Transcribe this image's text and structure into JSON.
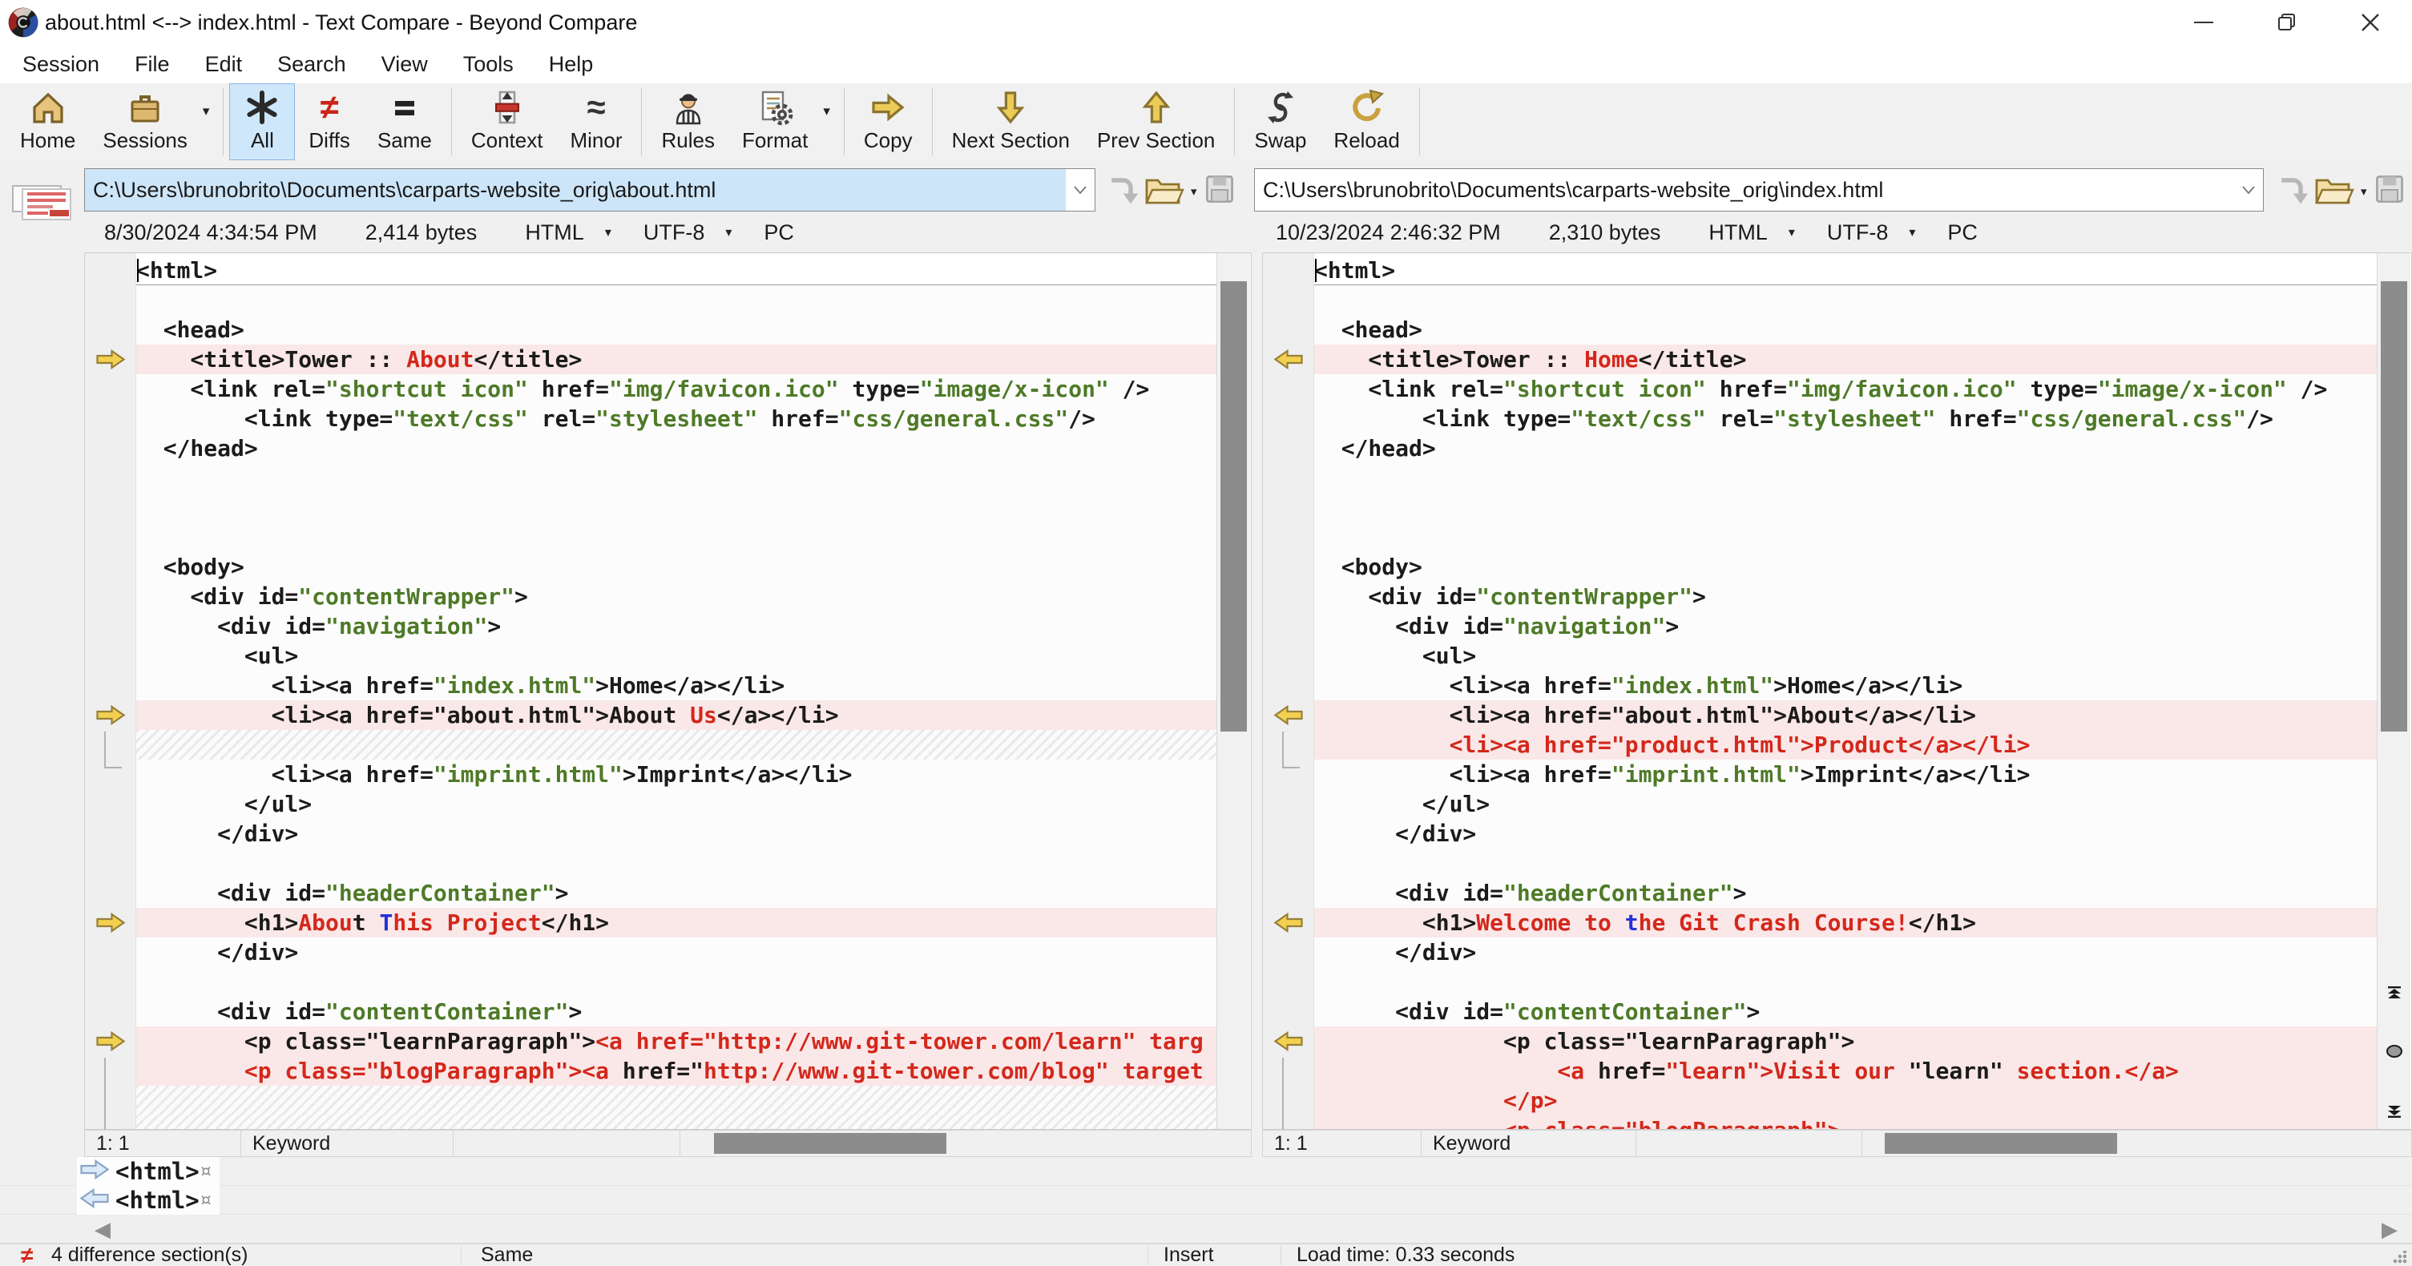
{
  "window": {
    "title": "about.html <--> index.html - Text Compare - Beyond Compare",
    "buttons": {
      "minimize": "minimize",
      "restore": "restore",
      "close": "close"
    }
  },
  "menu": {
    "items": [
      "Session",
      "File",
      "Edit",
      "Search",
      "View",
      "Tools",
      "Help"
    ]
  },
  "toolbar": {
    "groups": [
      [
        {
          "icon": "home-icon",
          "label": "Home"
        },
        {
          "icon": "sessions-icon",
          "label": "Sessions",
          "dropdown": true
        }
      ],
      [
        {
          "icon": "all-icon",
          "label": "All",
          "selected": true
        },
        {
          "icon": "diffs-icon",
          "label": "Diffs"
        },
        {
          "icon": "same-icon",
          "label": "Same"
        }
      ],
      [
        {
          "icon": "context-icon",
          "label": "Context"
        },
        {
          "icon": "minor-icon",
          "label": "Minor"
        }
      ],
      [
        {
          "icon": "rules-icon",
          "label": "Rules"
        },
        {
          "icon": "format-icon",
          "label": "Format",
          "dropdown": true
        }
      ],
      [
        {
          "icon": "copy-icon",
          "label": "Copy"
        }
      ],
      [
        {
          "icon": "next-section-icon",
          "label": "Next Section"
        },
        {
          "icon": "prev-section-icon",
          "label": "Prev Section"
        }
      ],
      [
        {
          "icon": "swap-icon",
          "label": "Swap"
        },
        {
          "icon": "reload-icon",
          "label": "Reload"
        }
      ]
    ]
  },
  "left_file": {
    "path": "C:\\Users\\brunobrito\\Documents\\carparts-website_orig\\about.html",
    "date": "8/30/2024 4:34:54 PM",
    "size": "2,414 bytes",
    "format": "HTML",
    "encoding": "UTF-8",
    "line_ending": "PC",
    "footer": {
      "position": "1: 1",
      "grammar": "Keyword"
    }
  },
  "right_file": {
    "path": "C:\\Users\\brunobrito\\Documents\\carparts-website_orig\\index.html",
    "date": "10/23/2024 2:46:32 PM",
    "size": "2,310 bytes",
    "format": "HTML",
    "encoding": "UTF-8",
    "line_ending": "PC",
    "footer": {
      "position": "1: 1",
      "grammar": "Keyword"
    }
  },
  "colors": {
    "diff_row_bg": "#fae7e7",
    "diff_text": "#d3281c",
    "unimportant_diff_text": "#2431d8",
    "string_value": "#4e7a27",
    "selected_path_bg": "#cde5f8",
    "selected_tool_bg": "#cfe7fb",
    "gutter_arrow": "#f3d04f",
    "scrollbar_thumb": "#8c8c8c"
  },
  "left_rows": [
    {
      "c": 1,
      "s": [
        [
          "k",
          "<html>"
        ]
      ]
    },
    {},
    {
      "s": [
        [
          "k",
          "  <head>"
        ]
      ]
    },
    {
      "d": 1,
      "a": 1,
      "s": [
        [
          "k",
          "    <title>Tower :: "
        ],
        [
          "r",
          "About"
        ],
        [
          "k",
          "</title>"
        ]
      ]
    },
    {
      "s": [
        [
          "k",
          "    <link rel="
        ],
        [
          "g",
          "\"shortcut icon\""
        ],
        [
          "k",
          " href="
        ],
        [
          "g",
          "\"img/favicon.ico\""
        ],
        [
          "k",
          " type="
        ],
        [
          "g",
          "\"image/x-icon\""
        ],
        [
          "k",
          " />"
        ]
      ]
    },
    {
      "s": [
        [
          "k",
          "        <link type="
        ],
        [
          "g",
          "\"text/css\""
        ],
        [
          "k",
          " rel="
        ],
        [
          "g",
          "\"stylesheet\""
        ],
        [
          "k",
          " href="
        ],
        [
          "g",
          "\"css/general.css\""
        ],
        [
          "k",
          "/>"
        ]
      ]
    },
    {
      "s": [
        [
          "k",
          "  </head>"
        ]
      ]
    },
    {},
    {},
    {},
    {
      "s": [
        [
          "k",
          "  <body>"
        ]
      ]
    },
    {
      "s": [
        [
          "k",
          "    <div id="
        ],
        [
          "g",
          "\"contentWrapper\""
        ],
        [
          "k",
          ">"
        ]
      ]
    },
    {
      "s": [
        [
          "k",
          "      <div id="
        ],
        [
          "g",
          "\"navigation\""
        ],
        [
          "k",
          ">"
        ]
      ]
    },
    {
      "s": [
        [
          "k",
          "        <ul>"
        ]
      ]
    },
    {
      "s": [
        [
          "k",
          "          <li><a href="
        ],
        [
          "g",
          "\"index.html\""
        ],
        [
          "k",
          ">Home</a></li>"
        ]
      ]
    },
    {
      "d": 1,
      "a": 1,
      "b": "corner",
      "s": [
        [
          "k",
          "          <li><a href=\"about.html\">About "
        ],
        [
          "r",
          "Us"
        ],
        [
          "k",
          "</a></li>"
        ]
      ]
    },
    {
      "g": 1
    },
    {
      "s": [
        [
          "k",
          "          <li><a href="
        ],
        [
          "g",
          "\"imprint.html\""
        ],
        [
          "k",
          ">Imprint</a></li>"
        ]
      ]
    },
    {
      "s": [
        [
          "k",
          "        </ul>"
        ]
      ]
    },
    {
      "s": [
        [
          "k",
          "      </div>"
        ]
      ]
    },
    {},
    {
      "s": [
        [
          "k",
          "      <div id="
        ],
        [
          "g",
          "\"headerContainer\""
        ],
        [
          "k",
          ">"
        ]
      ]
    },
    {
      "d": 1,
      "a": 1,
      "s": [
        [
          "k",
          "        <h1>"
        ],
        [
          "r",
          "Abou"
        ],
        [
          "k",
          "t "
        ],
        [
          "b",
          "T"
        ],
        [
          "r",
          "his Project"
        ],
        [
          "k",
          "</h1>"
        ]
      ]
    },
    {
      "s": [
        [
          "k",
          "      </div>"
        ]
      ]
    },
    {},
    {
      "s": [
        [
          "k",
          "      <div id="
        ],
        [
          "g",
          "\"contentContainer\""
        ],
        [
          "k",
          ">"
        ]
      ]
    },
    {
      "d": 1,
      "a": 1,
      "b": "line",
      "s": [
        [
          "k",
          "        <p class=\"learnParagraph\">"
        ],
        [
          "r",
          "<a href=\"http://www.git-tower.com/learn\" targ"
        ]
      ]
    },
    {
      "d": 1,
      "s": [
        [
          "r",
          "        <p class=\"blogParagraph\"><a "
        ],
        [
          "k",
          "href=\""
        ],
        [
          "r",
          "http://www.git-tower.com/blog\" target"
        ]
      ]
    },
    {
      "g": 1
    },
    {
      "g": 1
    }
  ],
  "right_rows": [
    {
      "c": 1,
      "s": [
        [
          "k",
          "<html>"
        ]
      ]
    },
    {},
    {
      "s": [
        [
          "k",
          "  <head>"
        ]
      ]
    },
    {
      "d": 1,
      "a": 1,
      "s": [
        [
          "k",
          "    <title>Tower :: "
        ],
        [
          "r",
          "Home"
        ],
        [
          "k",
          "</title>"
        ]
      ]
    },
    {
      "s": [
        [
          "k",
          "    <link rel="
        ],
        [
          "g",
          "\"shortcut icon\""
        ],
        [
          "k",
          " href="
        ],
        [
          "g",
          "\"img/favicon.ico\""
        ],
        [
          "k",
          " type="
        ],
        [
          "g",
          "\"image/x-icon\""
        ],
        [
          "k",
          " />"
        ]
      ]
    },
    {
      "s": [
        [
          "k",
          "        <link type="
        ],
        [
          "g",
          "\"text/css\""
        ],
        [
          "k",
          " rel="
        ],
        [
          "g",
          "\"stylesheet\""
        ],
        [
          "k",
          " href="
        ],
        [
          "g",
          "\"css/general.css\""
        ],
        [
          "k",
          "/>"
        ]
      ]
    },
    {
      "s": [
        [
          "k",
          "  </head>"
        ]
      ]
    },
    {},
    {},
    {},
    {
      "s": [
        [
          "k",
          "  <body>"
        ]
      ]
    },
    {
      "s": [
        [
          "k",
          "    <div id="
        ],
        [
          "g",
          "\"contentWrapper\""
        ],
        [
          "k",
          ">"
        ]
      ]
    },
    {
      "s": [
        [
          "k",
          "      <div id="
        ],
        [
          "g",
          "\"navigation\""
        ],
        [
          "k",
          ">"
        ]
      ]
    },
    {
      "s": [
        [
          "k",
          "        <ul>"
        ]
      ]
    },
    {
      "s": [
        [
          "k",
          "          <li><a href="
        ],
        [
          "g",
          "\"index.html\""
        ],
        [
          "k",
          ">Home</a></li>"
        ]
      ]
    },
    {
      "d": 1,
      "a": 1,
      "b": "corner",
      "s": [
        [
          "k",
          "          <li><a href=\"about.html\">About</a></li>"
        ]
      ]
    },
    {
      "d": 1,
      "s": [
        [
          "r",
          "          <li><a href=\"product.html\">Product</a></li>"
        ]
      ]
    },
    {
      "s": [
        [
          "k",
          "          <li><a href="
        ],
        [
          "g",
          "\"imprint.html\""
        ],
        [
          "k",
          ">Imprint</a></li>"
        ]
      ]
    },
    {
      "s": [
        [
          "k",
          "        </ul>"
        ]
      ]
    },
    {
      "s": [
        [
          "k",
          "      </div>"
        ]
      ]
    },
    {},
    {
      "s": [
        [
          "k",
          "      <div id="
        ],
        [
          "g",
          "\"headerContainer\""
        ],
        [
          "k",
          ">"
        ]
      ]
    },
    {
      "d": 1,
      "a": 1,
      "s": [
        [
          "k",
          "        <h1>"
        ],
        [
          "r",
          "Welcome to "
        ],
        [
          "b",
          "t"
        ],
        [
          "r",
          "he Git Crash Course!"
        ],
        [
          "k",
          "</h1>"
        ]
      ]
    },
    {
      "s": [
        [
          "k",
          "      </div>"
        ]
      ]
    },
    {},
    {
      "s": [
        [
          "k",
          "      <div id="
        ],
        [
          "g",
          "\"contentContainer\""
        ],
        [
          "k",
          ">"
        ]
      ]
    },
    {
      "d": 1,
      "a": 1,
      "b": "line",
      "s": [
        [
          "k",
          "              <p class=\"learnParagraph\">"
        ]
      ]
    },
    {
      "d": 1,
      "s": [
        [
          "r",
          "                  <a "
        ],
        [
          "k",
          "href="
        ],
        [
          "r",
          "\"learn\">Visit our "
        ],
        [
          "k",
          "\"learn\""
        ],
        [
          "r",
          " section.</a>"
        ]
      ]
    },
    {
      "d": 1,
      "s": [
        [
          "r",
          "              </p>"
        ]
      ]
    },
    {
      "d": 1,
      "s": [
        [
          "r",
          "              <p class=\"blogParagraph\">"
        ]
      ]
    }
  ],
  "detail_rows": [
    {
      "dir": "right",
      "text": "<html>",
      "eol": "¤"
    },
    {
      "dir": "left",
      "text": "<html>",
      "eol": "¤"
    }
  ],
  "status_bar": {
    "diff_glyph": "≠",
    "sections": "4 difference section(s)",
    "mode": "Same",
    "edit_mode": "Insert",
    "load_time": "Load time: 0.33 seconds"
  }
}
